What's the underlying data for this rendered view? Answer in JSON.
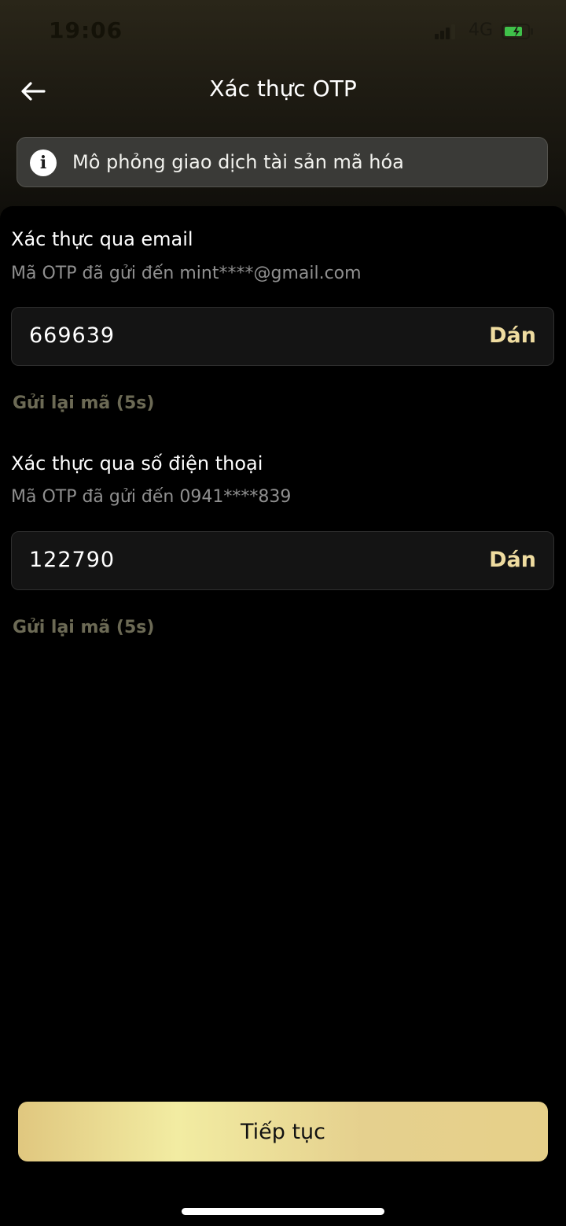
{
  "status_bar": {
    "time": "19:06",
    "network": "4G",
    "icons": [
      "signal-icon",
      "battery-icon"
    ],
    "battery_color": "#3fc14a"
  },
  "header": {
    "back_icon": "arrow-left-icon",
    "title": "Xác thực OTP"
  },
  "banner": {
    "icon": "info-icon",
    "icon_glyph": "i",
    "text": "Mô phỏng giao dịch tài sản mã hóa"
  },
  "email_section": {
    "title": "Xác thực qua email",
    "subtitle": "Mã OTP đã gửi đến mint****@gmail.com",
    "otp_value": "669639",
    "paste_label": "Dán",
    "resend_label": "Gửi lại mã (5s)"
  },
  "phone_section": {
    "title": "Xác thực qua số điện thoại",
    "subtitle": "Mã OTP đã gửi đến 0941****839",
    "otp_value": "122790",
    "paste_label": "Dán",
    "resend_label": "Gửi lại mã (5s)"
  },
  "continue_button": {
    "label": "Tiếp tục"
  },
  "colors": {
    "accent": "#efdca0",
    "button_gradient_start": "#e0c77f",
    "button_gradient_mid": "#f2eca2",
    "muted_text": "#8f8f8f",
    "disabled_link": "#6c6a55"
  }
}
